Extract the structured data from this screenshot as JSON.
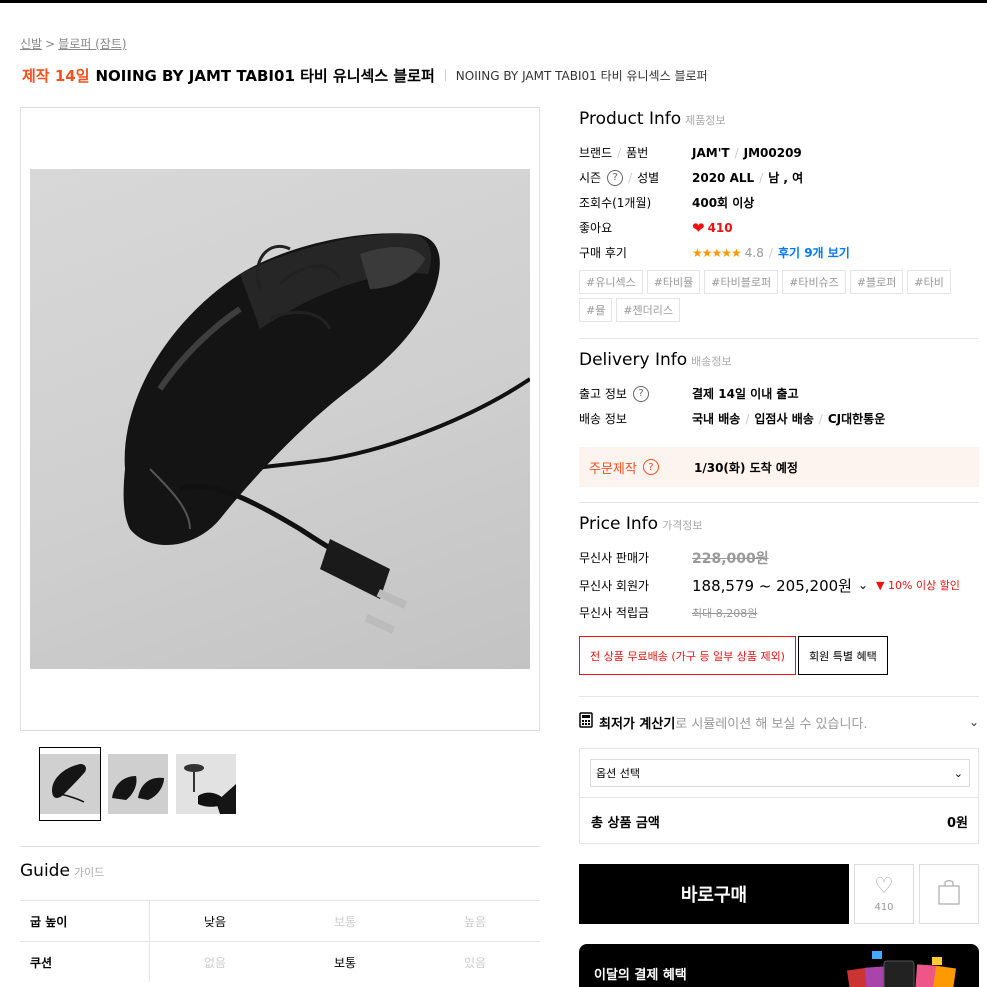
{
  "breadcrumb": {
    "items": [
      "신발",
      "블로퍼 (잠트)"
    ],
    "separator": ">"
  },
  "title": {
    "badge": "제작 14일",
    "name": "NOIING BY JAMT TABI01 타비 유니섹스 블로퍼",
    "subtitle": "NOIING BY JAMT TABI01 타비 유니섹스 블로퍼"
  },
  "product_info": {
    "title": "Product Info",
    "title_sub": "제품정보",
    "brand_label": "브랜드",
    "item_no_label": "품번",
    "brand": "JAM'T",
    "item_no": "JM00209",
    "season_label": "시즌",
    "gender_label": "성별",
    "season": "2020 ALL",
    "gender": "남 , 여",
    "views_label": "조회수(1개월)",
    "views": "400회 이상",
    "likes_label": "좋아요",
    "likes": "410",
    "review_label": "구매 후기",
    "stars": "★★★★★",
    "rating": "4.8",
    "review_link": "후기 9개 보기",
    "tags": [
      "#유니섹스",
      "#타비뮬",
      "#타비블로퍼",
      "#타비슈즈",
      "#블로퍼",
      "#타비",
      "#뮬",
      "#젠더리스"
    ]
  },
  "delivery_info": {
    "title": "Delivery Info",
    "title_sub": "배송정보",
    "ship_label": "출고 정보",
    "ship_value": "결제 14일 이내 출고",
    "delivery_label": "배송 정보",
    "delivery_1": "국내 배송",
    "delivery_2": "입점사 배송",
    "delivery_3": "CJ대한통운",
    "custom_label": "주문제작",
    "custom_value": "1/30(화) 도착 예정"
  },
  "price_info": {
    "title": "Price Info",
    "title_sub": "가격정보",
    "sale_label": "무신사 판매가",
    "sale_price": "228,000원",
    "member_label": "무신사 회원가",
    "member_price": "188,579 ~ 205,200원",
    "discount": "10% 이상 할인",
    "points_label": "무신사 적립금",
    "points_value": "최대 8,208원",
    "promo_free": "전 상품 무료배송 (가구 등 일부 상품 제외)",
    "promo_member": "회원 특별 혜택"
  },
  "calculator": {
    "bold": "최저가 계산기",
    "text": "로 시뮬레이션 해 보실 수 있습니다."
  },
  "order": {
    "option_placeholder": "옵션 선택",
    "total_label": "총 상품 금액",
    "total_value": "0원",
    "buy_label": "바로구매",
    "like_count": "410"
  },
  "banner": {
    "text": "이달의 결제 혜택"
  },
  "guide": {
    "title": "Guide",
    "title_sub": "가이드",
    "rows": [
      {
        "label": "굽 높이",
        "options": [
          "낮음",
          "보통",
          "높음"
        ],
        "selected": 0
      },
      {
        "label": "쿠션",
        "options": [
          "없음",
          "보통",
          "있음"
        ],
        "selected": 1
      }
    ]
  },
  "colors": {
    "accent": "#f4511e",
    "red": "#ee1111",
    "link": "#0078ff",
    "star": "#ff9900"
  }
}
